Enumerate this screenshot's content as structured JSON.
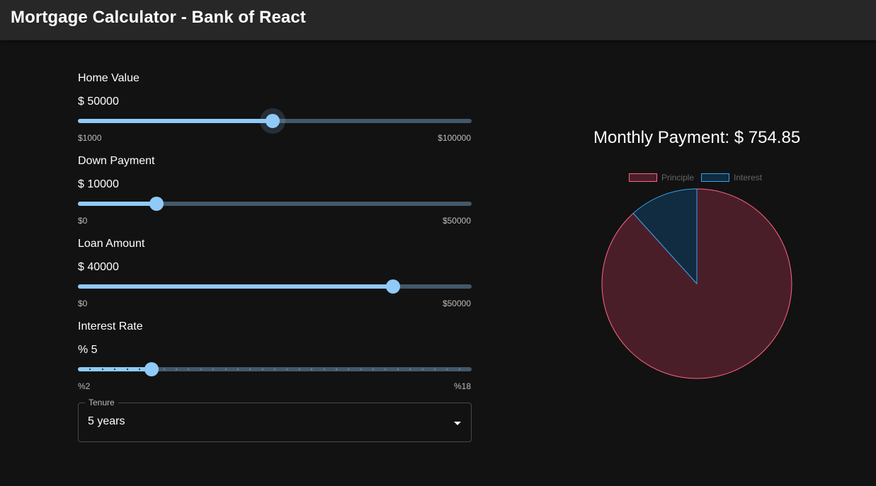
{
  "appbar": {
    "title": "Mortgage Calculator - Bank of React"
  },
  "sliders": {
    "home_value": {
      "label": "Home Value",
      "value_text": "$ 50000",
      "min_label": "$1000",
      "max_label": "$100000",
      "min": 1000,
      "max": 100000,
      "value": 50000
    },
    "down_payment": {
      "label": "Down Payment",
      "value_text": "$ 10000",
      "min_label": "$0",
      "max_label": "$50000",
      "min": 0,
      "max": 50000,
      "value": 10000
    },
    "loan_amount": {
      "label": "Loan Amount",
      "value_text": "$ 40000",
      "min_label": "$0",
      "max_label": "$50000",
      "min": 0,
      "max": 50000,
      "value": 40000
    },
    "interest_rate": {
      "label": "Interest Rate",
      "value_text": "% 5",
      "min_label": "%2",
      "max_label": "%18",
      "min": 2,
      "max": 18,
      "value": 5
    }
  },
  "tenure": {
    "legend": "Tenure",
    "value": "5 years"
  },
  "result": {
    "monthly_payment": "Monthly Payment: $ 754.85"
  },
  "colors": {
    "accent": "#90caf9",
    "principle_border": "#ff6384",
    "principle_fill": "#4a1e28",
    "interest_border": "#36a2eb",
    "interest_fill": "#112b40",
    "background": "#121212",
    "appbar": "#272727"
  },
  "chart_data": {
    "type": "pie",
    "labels": [
      "Principle",
      "Interest"
    ],
    "values": [
      40000,
      5291
    ],
    "legend": "top"
  }
}
